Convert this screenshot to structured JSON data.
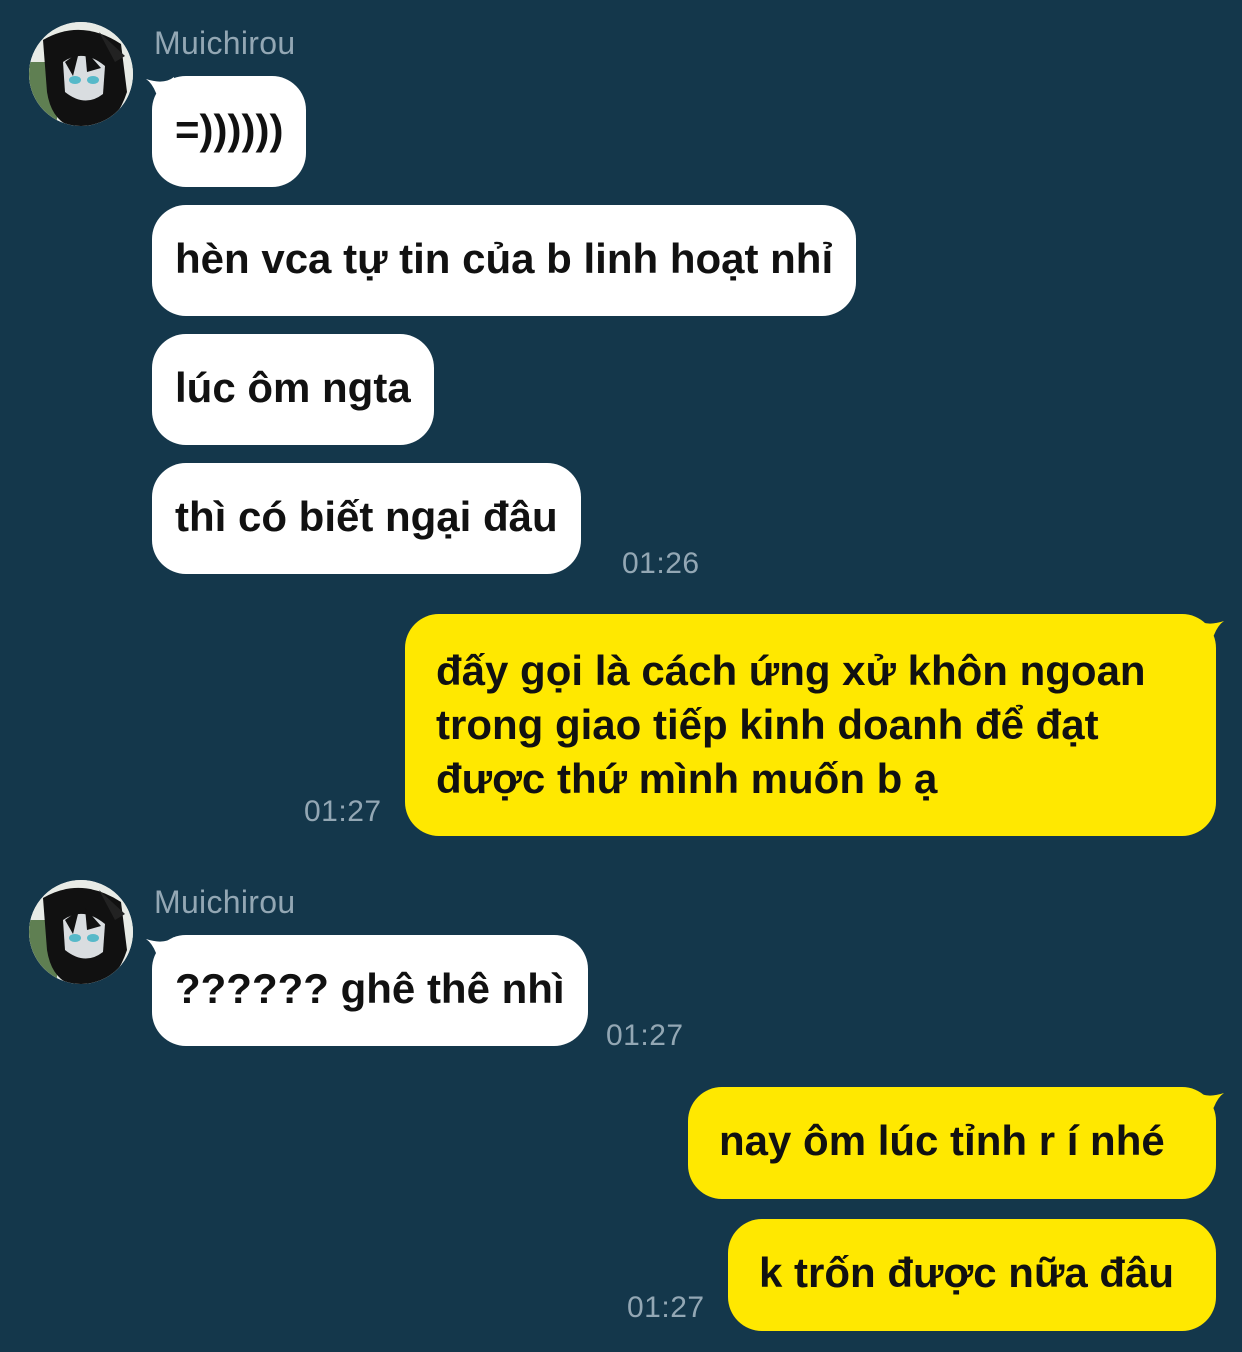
{
  "colors": {
    "background": "#14374b",
    "incoming_bubble": "#ffffff",
    "outgoing_bubble": "#ffe800",
    "meta_text": "#93a7b4"
  },
  "groups": [
    {
      "sender": "Muichirou",
      "avatar_icon": "anime-character-avatar-icon",
      "messages": [
        "=))))))",
        "hèn vca tự tin của b linh hoạt nhỉ",
        "lúc ôm ngta",
        "thì có biết ngại đâu"
      ],
      "time": "01:26"
    },
    {
      "sender": "me",
      "messages": [
        "đấy gọi là cách ứng xử khôn ngoan trong giao tiếp kinh doanh để đạt được thứ mình muốn b ạ"
      ],
      "time": "01:27"
    },
    {
      "sender": "Muichirou",
      "avatar_icon": "anime-character-avatar-icon",
      "messages": [
        "?????? ghê thê nhì"
      ],
      "time": "01:27"
    },
    {
      "sender": "me",
      "messages": [
        "nay ôm lúc tỉnh r í nhé",
        "k trốn được nữa đâu"
      ],
      "time": "01:27"
    }
  ]
}
